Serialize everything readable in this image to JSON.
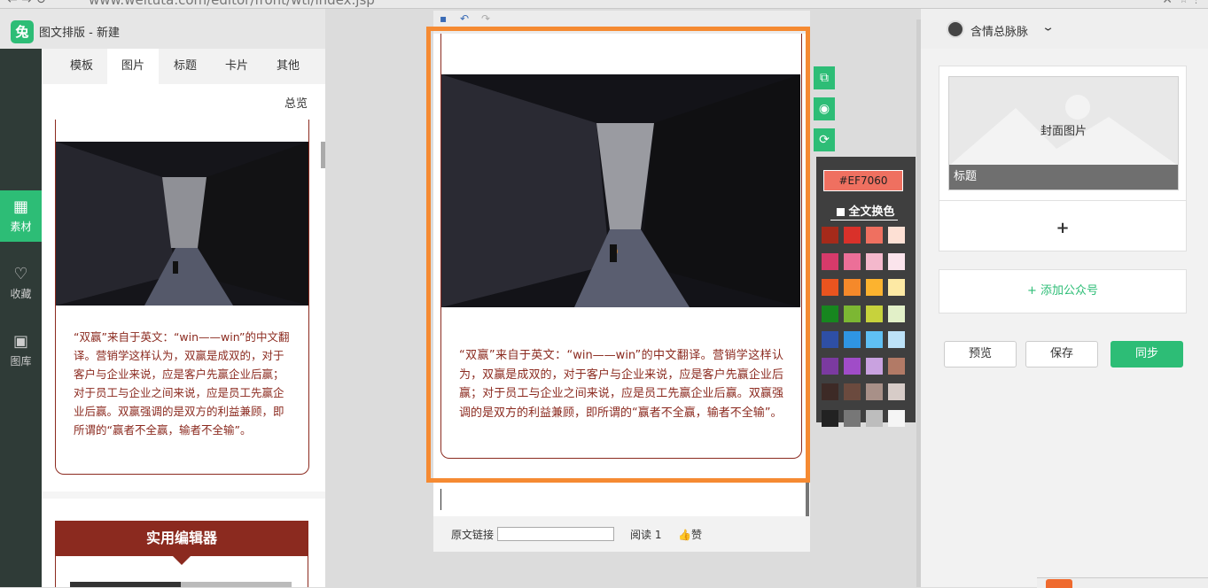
{
  "browser": {
    "url": "www.weituta.com/editor/front/wtl/index.jsp"
  },
  "app": {
    "logo": "兔",
    "breadcrumb": "图文排版 - 新建"
  },
  "rail": [
    {
      "icon": "▦",
      "label": "素材"
    },
    {
      "icon": "♡",
      "label": "收藏"
    },
    {
      "icon": "▣",
      "label": "图库"
    }
  ],
  "material": {
    "tabs": [
      "模板",
      "图片",
      "标题",
      "卡片",
      "其他"
    ],
    "active_tab": "图片",
    "overview": "总览",
    "card_text": "“双赢”来自于英文：“win——win”的中文翻译。营销学这样认为，双赢是成双的，对于客户与企业来说，应是客户先赢企业后赢；对于员工与企业之间来说，应是员工先赢企业后赢。双赢强调的是双方的利益兼顾，即所谓的“赢者不全赢，输者不全输”。",
    "card2_title": "实用编辑器"
  },
  "editor": {
    "article_text": "“双赢”来自于英文：“win——win”的中文翻译。营销学这样认为，双赢是成双的，对于客户与企业来说，应是客户先赢企业后赢；对于员工与企业之间来说，应是员工先赢企业后赢。双赢强调的是双方的利益兼顾，即所谓的“赢者不全赢，输者不全输”。",
    "footer": {
      "original_link_label": "原文链接",
      "read_label": "阅读 1",
      "like_label": "👍赞"
    }
  },
  "palette": {
    "current_hex": "#EF7060",
    "full_color_label": "全文换色",
    "swatches": [
      [
        "#a52a1a",
        "#d9312a",
        "#ef7060",
        "#fde0d4"
      ],
      [
        "#d63a6a",
        "#ec6f98",
        "#f4b8cc",
        "#fbe4ec"
      ],
      [
        "#e9541f",
        "#f5892a",
        "#fcb32f",
        "#fde9a4"
      ],
      [
        "#17861f",
        "#7cb733",
        "#c7d23c",
        "#e2f0c8"
      ],
      [
        "#2e4fa5",
        "#2f95e3",
        "#5fc0f4",
        "#bde2f8"
      ],
      [
        "#7b3aa0",
        "#a04cc8",
        "#c9a2e0",
        "#b27a66"
      ],
      [
        "#3d2a26",
        "#6b4a3e",
        "#a89088",
        "#d7ccc8"
      ],
      [
        "#222222",
        "#777777",
        "#bdbdbd",
        "#f5f5f5"
      ]
    ]
  },
  "right": {
    "account": "含情总脉脉",
    "cover_caption": "封面图片",
    "cover_title": "标题",
    "add_symbol": "+",
    "add_account": "+ 添加公众号",
    "buttons": {
      "preview": "预览",
      "save": "保存",
      "sync": "同步"
    }
  }
}
